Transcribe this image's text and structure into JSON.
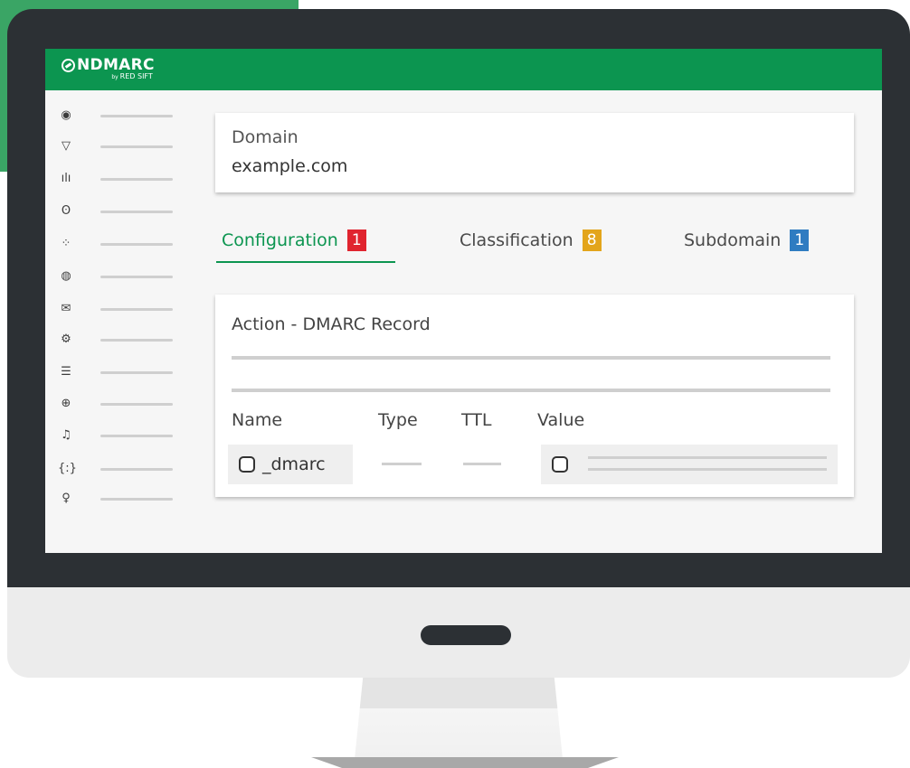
{
  "app": {
    "logo_text": "NDMARC",
    "logo_by": "by",
    "logo_sub": "RED SIFT"
  },
  "sidebar": {
    "items": [
      {
        "icon": "dashboard-icon",
        "glyph": "◉"
      },
      {
        "icon": "shield-icon",
        "glyph": "▽"
      },
      {
        "icon": "bar-chart-icon",
        "glyph": "ılı"
      },
      {
        "icon": "fingerprint-icon",
        "glyph": "ʘ"
      },
      {
        "icon": "apps-icon",
        "glyph": "⁘"
      },
      {
        "icon": "globe-icon",
        "glyph": "◍"
      },
      {
        "icon": "mail-icon",
        "glyph": "✉"
      },
      {
        "icon": "gear-icon",
        "glyph": "⚙"
      },
      {
        "icon": "list-icon",
        "glyph": "☰"
      },
      {
        "icon": "target-icon",
        "glyph": "⊕"
      },
      {
        "icon": "bell-icon",
        "glyph": "♫"
      },
      {
        "icon": "code-icon",
        "glyph": "{:}"
      },
      {
        "icon": "user-icon",
        "glyph": "♀"
      }
    ]
  },
  "domain": {
    "label": "Domain",
    "value": "example.com"
  },
  "tabs": [
    {
      "label": "Configuration",
      "count": "1",
      "color": "#e0242f",
      "active": true
    },
    {
      "label": "Classification",
      "count": "8",
      "color": "#e3a51b",
      "active": false
    },
    {
      "label": "Subdomain",
      "count": "1",
      "color": "#2f7cc1",
      "active": false
    }
  ],
  "action": {
    "title": "Action - DMARC Record",
    "columns": [
      "Name",
      "Type",
      "TTL",
      "Value"
    ],
    "row": {
      "name": "_dmarc"
    }
  },
  "colors": {
    "brand_green": "#0c9550",
    "bezel": "#2c3034"
  }
}
